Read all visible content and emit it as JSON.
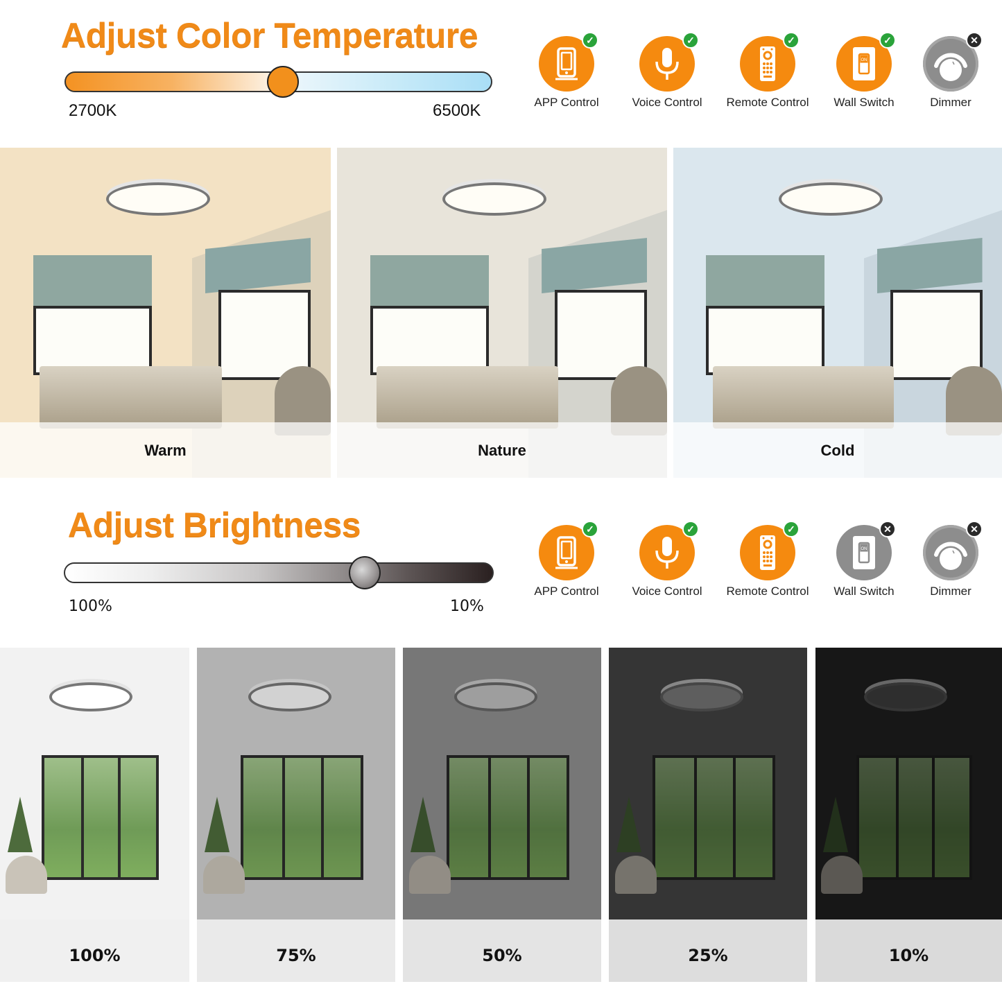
{
  "color_temperature": {
    "title": "Adjust Color Temperature",
    "min_label": "2700K",
    "max_label": "6500K",
    "slider_position_fraction": 0.51,
    "controls": [
      {
        "label": "APP Control",
        "icon": "smartphone-icon",
        "supported": true
      },
      {
        "label": "Voice Control",
        "icon": "microphone-icon",
        "supported": true
      },
      {
        "label": "Remote Control",
        "icon": "remote-control-icon",
        "supported": true
      },
      {
        "label": "Wall Switch",
        "icon": "wall-switch-icon",
        "supported": true
      },
      {
        "label": "Dimmer",
        "icon": "dimmer-knob-icon",
        "supported": false
      }
    ],
    "panels": [
      {
        "caption": "Warm",
        "tint": "#f3e2c4"
      },
      {
        "caption": "Nature",
        "tint": "#e8e4da"
      },
      {
        "caption": "Cold",
        "tint": "#dbe7ee"
      }
    ]
  },
  "brightness": {
    "title": "Adjust Brightness",
    "min_label": "100%",
    "max_label": "10%",
    "slider_position_fraction": 0.7,
    "controls": [
      {
        "label": "APP Control",
        "icon": "smartphone-icon",
        "supported": true
      },
      {
        "label": "Voice Control",
        "icon": "microphone-icon",
        "supported": true
      },
      {
        "label": "Remote Control",
        "icon": "remote-control-icon",
        "supported": true
      },
      {
        "label": "Wall Switch",
        "icon": "wall-switch-icon",
        "supported": false
      },
      {
        "label": "Dimmer",
        "icon": "dimmer-knob-icon",
        "supported": false
      }
    ],
    "panels": [
      {
        "caption": "100%",
        "shade": "#f2f2f2"
      },
      {
        "caption": "75%",
        "shade": "#cfcfcf"
      },
      {
        "caption": "50%",
        "shade": "#a4a4a4"
      },
      {
        "caption": "25%",
        "shade": "#5a5a5a"
      },
      {
        "caption": "10%",
        "shade": "#333333"
      }
    ]
  },
  "colors": {
    "accent_orange": "#f08a18",
    "supported_badge": "#2aa33a",
    "unsupported_badge": "#2a2a2a",
    "disabled_icon": "#8d8d8d"
  }
}
